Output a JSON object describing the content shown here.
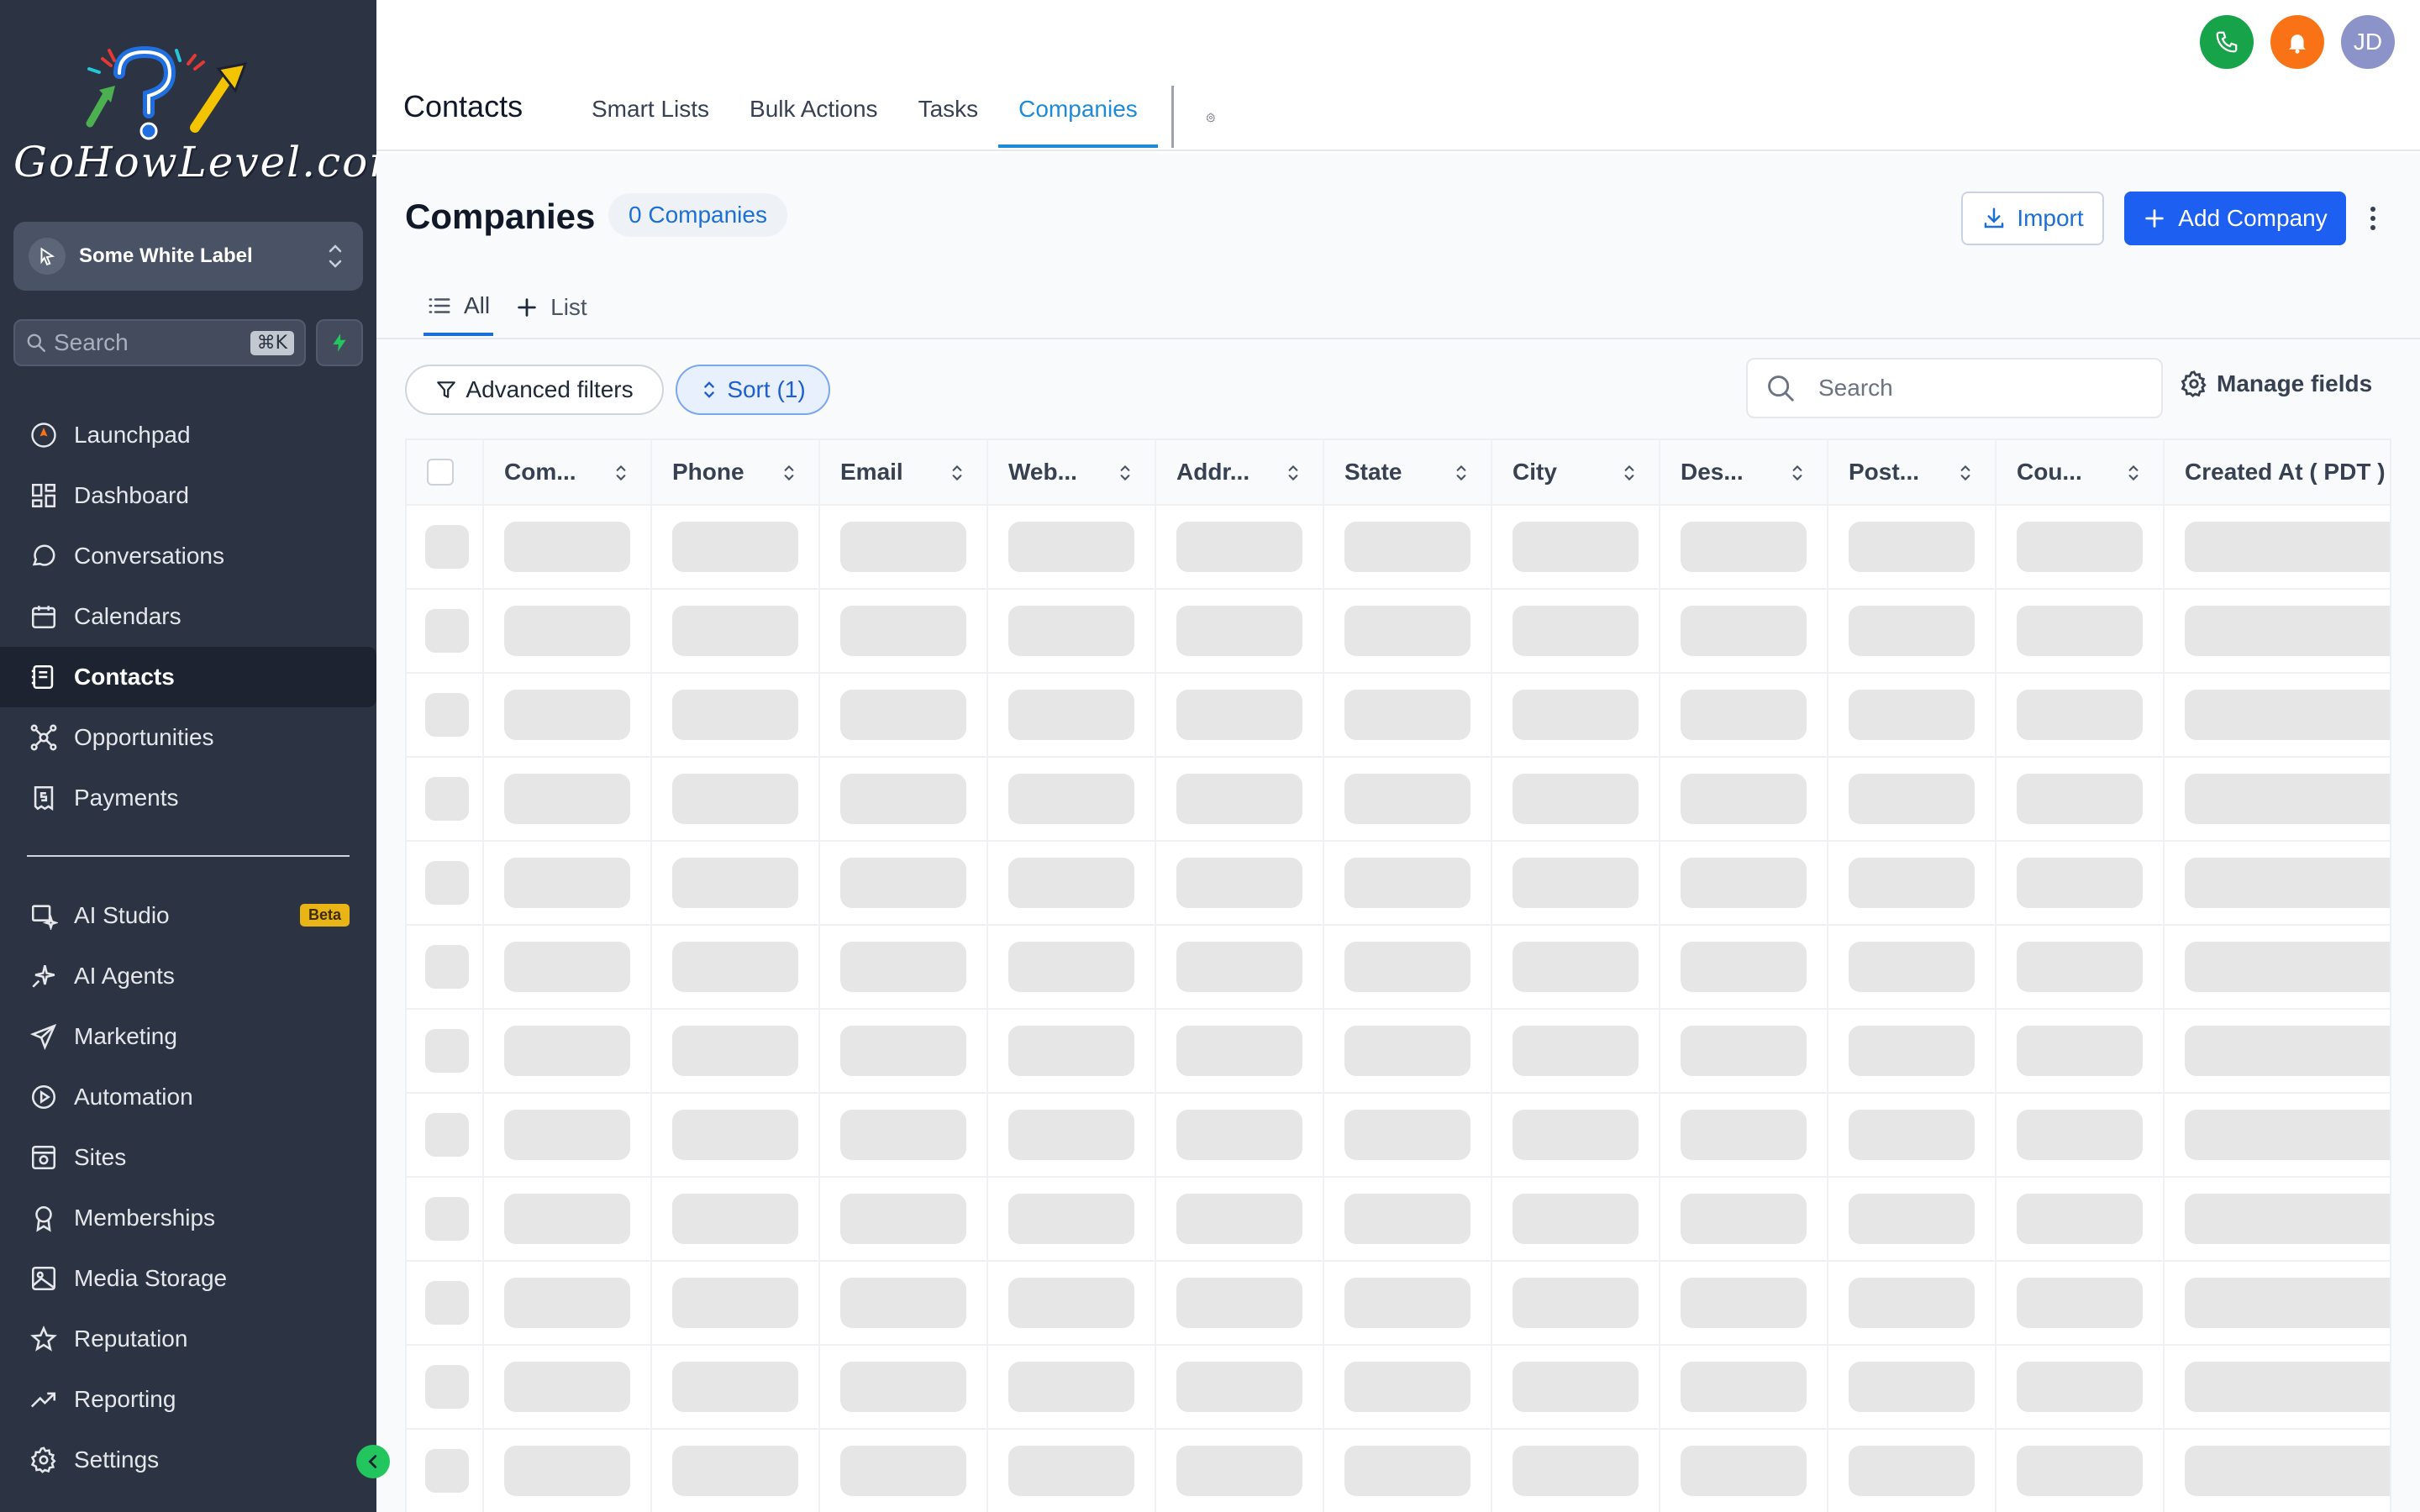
{
  "sidebar": {
    "logo_text": "GoHowLevel.com",
    "account": {
      "name": "Some White Label"
    },
    "search": {
      "placeholder": "Search",
      "shortcut": "⌘K"
    },
    "nav_primary": [
      {
        "label": "Launchpad",
        "icon": "rocket-icon"
      },
      {
        "label": "Dashboard",
        "icon": "dashboard-icon"
      },
      {
        "label": "Conversations",
        "icon": "chat-icon"
      },
      {
        "label": "Calendars",
        "icon": "calendar-icon"
      },
      {
        "label": "Contacts",
        "icon": "contacts-icon",
        "active": true
      },
      {
        "label": "Opportunities",
        "icon": "opportunities-icon"
      },
      {
        "label": "Payments",
        "icon": "payments-icon"
      }
    ],
    "nav_secondary": [
      {
        "label": "AI Studio",
        "icon": "ai-studio-icon",
        "badge": "Beta"
      },
      {
        "label": "AI Agents",
        "icon": "sparkle-icon"
      },
      {
        "label": "Marketing",
        "icon": "send-icon"
      },
      {
        "label": "Automation",
        "icon": "automation-icon"
      },
      {
        "label": "Sites",
        "icon": "sites-icon"
      },
      {
        "label": "Memberships",
        "icon": "badge-icon"
      },
      {
        "label": "Media Storage",
        "icon": "image-icon"
      },
      {
        "label": "Reputation",
        "icon": "star-icon"
      },
      {
        "label": "Reporting",
        "icon": "trend-icon"
      },
      {
        "label": "Settings",
        "icon": "gear-icon"
      }
    ]
  },
  "header": {
    "section_title": "Contacts",
    "tabs": [
      {
        "label": "Smart Lists"
      },
      {
        "label": "Bulk Actions"
      },
      {
        "label": "Tasks"
      },
      {
        "label": "Companies",
        "active": true
      }
    ],
    "avatar_initials": "JD"
  },
  "page": {
    "title": "Companies",
    "count_label": "0 Companies",
    "import_label": "Import",
    "add_label": "Add Company",
    "view_tabs": {
      "all": "All",
      "list": "List"
    },
    "filters_label": "Advanced filters",
    "sort_label": "Sort (1)",
    "search_placeholder": "Search",
    "manage_fields_label": "Manage fields"
  },
  "table": {
    "columns": [
      "Com...",
      "Phone",
      "Email",
      "Web...",
      "Addr...",
      "State",
      "City",
      "Des...",
      "Post...",
      "Cou...",
      "Created At ( PDT )"
    ],
    "loading_rows": 12
  },
  "colors": {
    "sidebar_bg": "#2c3444",
    "accent_blue": "#1d5ff0",
    "active_tab": "#1d8bd8",
    "phone_green": "#16a34a",
    "bell_orange": "#f97316",
    "skeleton": "#e6e6e6"
  }
}
